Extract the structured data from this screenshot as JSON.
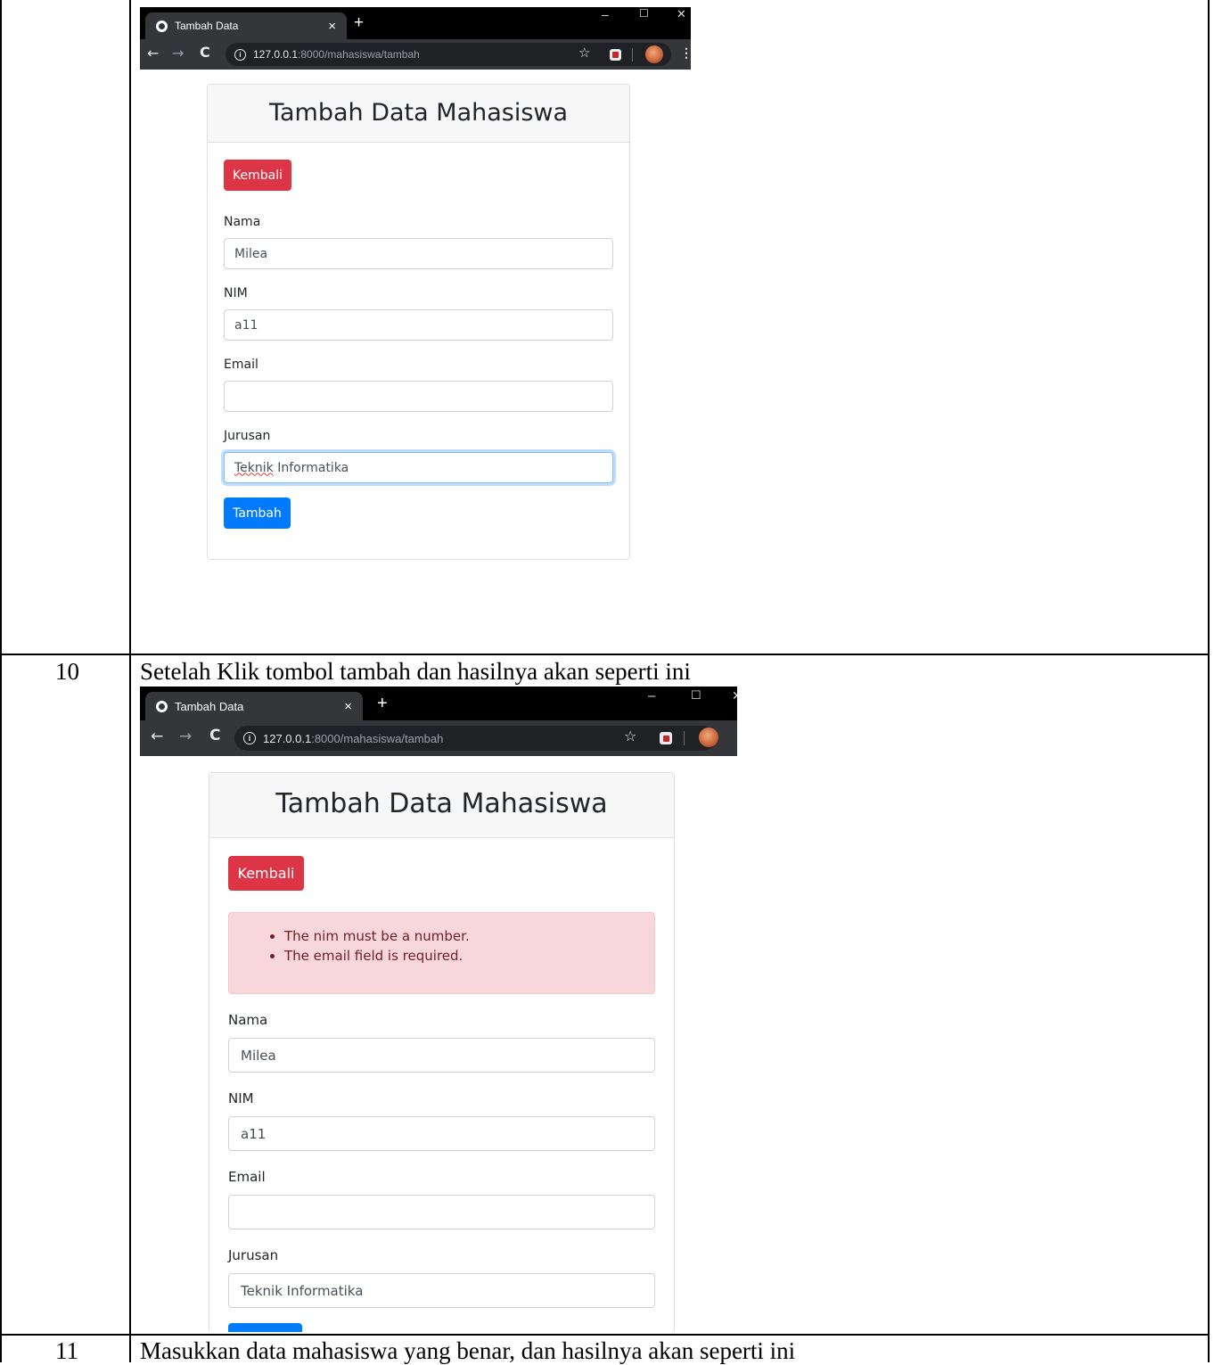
{
  "doc": {
    "row10_number": "10",
    "row10_text": "Setelah Klik tombol tambah dan hasilnya akan seperti ini",
    "row11_number": "11",
    "row11_text": "Masukkan data mahasiswa yang benar, dan hasilnya akan seperti ini"
  },
  "shot1": {
    "tab_title": "Tambah Data",
    "tab_close": "×",
    "new_tab": "+",
    "win_min": "–",
    "win_max": "☐",
    "win_close": "✕",
    "url_host": "127.0.0.1",
    "url_path": ":8000/mahasiswa/tambah",
    "card_title": "Tambah Data Mahasiswa",
    "back_button": "Kembali",
    "nama_label": "Nama",
    "nama_value": "Milea",
    "nim_label": "NIM",
    "nim_value": "a11",
    "email_label": "Email",
    "email_value": "",
    "jurusan_label": "Jurusan",
    "jurusan_value_word1": "Teknik",
    "jurusan_value_word2": " Informatika",
    "submit_button": "Tambah"
  },
  "shot2": {
    "tab_title": "Tambah Data",
    "tab_close": "×",
    "new_tab": "+",
    "win_min": "–",
    "win_max": "☐",
    "win_close": "✕",
    "url_host": "127.0.0.1",
    "url_path": ":8000/mahasiswa/tambah",
    "card_title": "Tambah Data Mahasiswa",
    "back_button": "Kembali",
    "errors": [
      "The nim must be a number.",
      "The email field is required."
    ],
    "nama_label": "Nama",
    "nama_value": "Milea",
    "nim_label": "NIM",
    "nim_value": "a11",
    "email_label": "Email",
    "email_value": "",
    "jurusan_label": "Jurusan",
    "jurusan_value": "Teknik Informatika"
  },
  "icons": {
    "back": "arrow-left-icon",
    "forward": "arrow-right-icon",
    "reload": "reload-icon",
    "info": "info-icon",
    "star": "star-icon",
    "extension": "extension-icon",
    "avatar": "avatar-icon",
    "menu": "kebab-menu-icon"
  },
  "colors": {
    "danger": "#dc3545",
    "primary": "#007bff",
    "alert_bg": "#f8d7da",
    "alert_text": "#721c24",
    "chrome_dark": "#35363a"
  }
}
